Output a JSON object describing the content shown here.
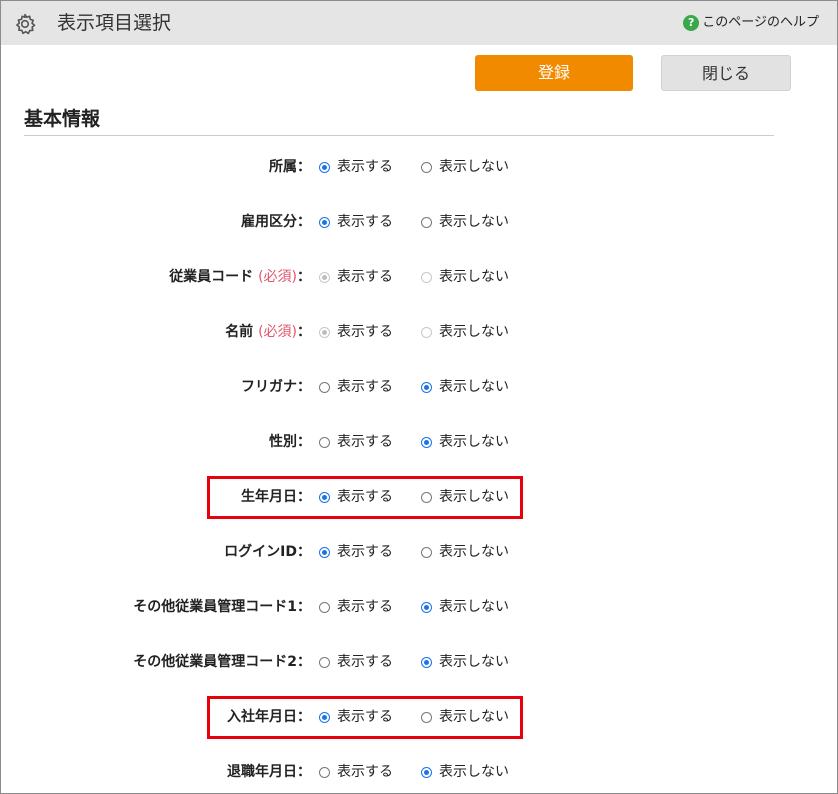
{
  "window": {
    "title": "表示項目選択",
    "help_label": "このページのヘルプ"
  },
  "actions": {
    "register_label": "登録",
    "close_label": "閉じる"
  },
  "section": {
    "title": "基本情報"
  },
  "options": {
    "show": "表示する",
    "hide": "表示しない"
  },
  "fields": [
    {
      "label": "所属",
      "required": false,
      "selected": "show",
      "disabled": false,
      "highlighted": false
    },
    {
      "label": "雇用区分",
      "required": false,
      "selected": "show",
      "disabled": false,
      "highlighted": false
    },
    {
      "label": "従業員コード",
      "required": true,
      "selected": "show",
      "disabled": true,
      "highlighted": false
    },
    {
      "label": "名前",
      "required": true,
      "selected": "show",
      "disabled": true,
      "highlighted": false
    },
    {
      "label": "フリガナ",
      "required": false,
      "selected": "hide",
      "disabled": false,
      "highlighted": false
    },
    {
      "label": "性別",
      "required": false,
      "selected": "hide",
      "disabled": false,
      "highlighted": false
    },
    {
      "label": "生年月日",
      "required": false,
      "selected": "show",
      "disabled": false,
      "highlighted": true
    },
    {
      "label": "ログインID",
      "required": false,
      "selected": "show",
      "disabled": false,
      "highlighted": false
    },
    {
      "label": "その他従業員管理コード1",
      "required": false,
      "selected": "hide",
      "disabled": false,
      "highlighted": false
    },
    {
      "label": "その他従業員管理コード2",
      "required": false,
      "selected": "hide",
      "disabled": false,
      "highlighted": false
    },
    {
      "label": "入社年月日",
      "required": false,
      "selected": "show",
      "disabled": false,
      "highlighted": true
    },
    {
      "label": "退職年月日",
      "required": false,
      "selected": "hide",
      "disabled": false,
      "highlighted": false
    }
  ],
  "required_text": "(必須)",
  "colon": "：",
  "colors": {
    "accent": "#f28a00",
    "radio": "#1a73e8",
    "highlight": "#e8000b",
    "required": "#e0566a"
  },
  "icons": {
    "settings": "gear-icon",
    "help": "help-icon"
  }
}
